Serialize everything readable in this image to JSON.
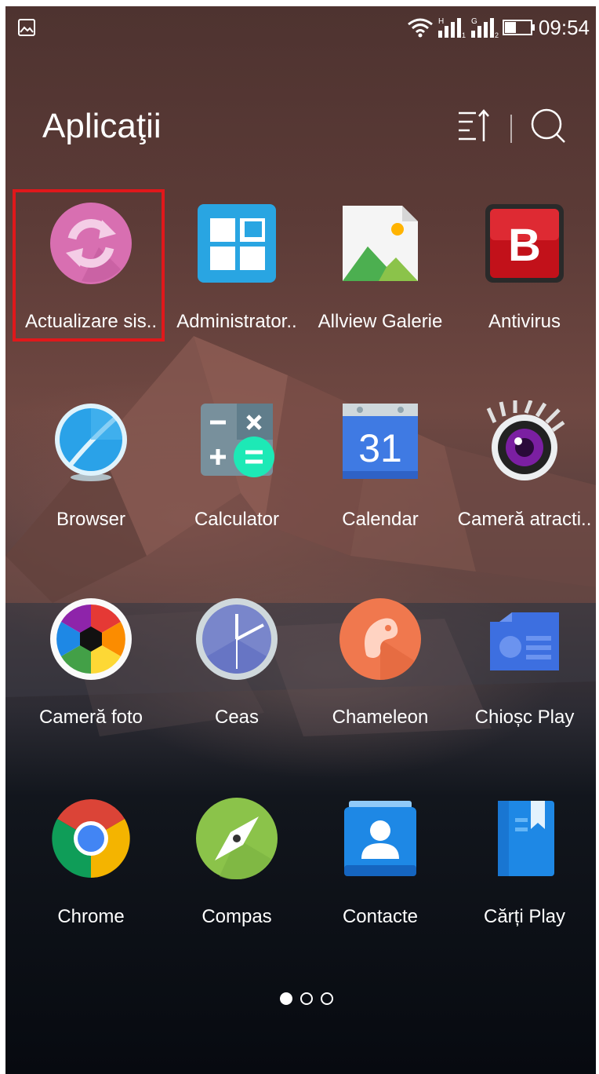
{
  "status_bar": {
    "time": "09:54",
    "icons": [
      "image-notification-icon",
      "wifi-icon",
      "signal-sim1-icon",
      "signal-sim2-icon",
      "battery-icon"
    ],
    "sim1_type": "H",
    "sim1_slot": "1",
    "sim2_type": "G",
    "sim2_slot": "2"
  },
  "header": {
    "title": "Aplicaţii",
    "sort_icon": "sort-icon",
    "search_icon": "search-icon"
  },
  "apps": [
    {
      "label": "Actualizare sis..",
      "icon": "system-update-icon"
    },
    {
      "label": "Administrator..",
      "icon": "administrator-icon"
    },
    {
      "label": "Allview Galerie",
      "icon": "gallery-icon"
    },
    {
      "label": "Antivirus",
      "icon": "antivirus-icon"
    },
    {
      "label": "Browser",
      "icon": "browser-icon"
    },
    {
      "label": "Calculator",
      "icon": "calculator-icon"
    },
    {
      "label": "Calendar",
      "icon": "calendar-icon",
      "day": "31"
    },
    {
      "label": "Cameră atracti..",
      "icon": "attraction-camera-icon"
    },
    {
      "label": "Cameră foto",
      "icon": "camera-icon"
    },
    {
      "label": "Ceas",
      "icon": "clock-icon"
    },
    {
      "label": "Chameleon",
      "icon": "chameleon-icon"
    },
    {
      "label": "Chioșc Play",
      "icon": "play-kiosk-icon"
    },
    {
      "label": "Chrome",
      "icon": "chrome-icon"
    },
    {
      "label": "Compas",
      "icon": "compass-icon"
    },
    {
      "label": "Contacte",
      "icon": "contacts-icon"
    },
    {
      "label": "Cărți Play",
      "icon": "play-books-icon"
    }
  ],
  "highlighted_app": "Actualizare sis..",
  "pager": {
    "pages": 3,
    "current": 1
  },
  "colors": {
    "highlight": "#e0181b",
    "label": "#ffffff"
  }
}
